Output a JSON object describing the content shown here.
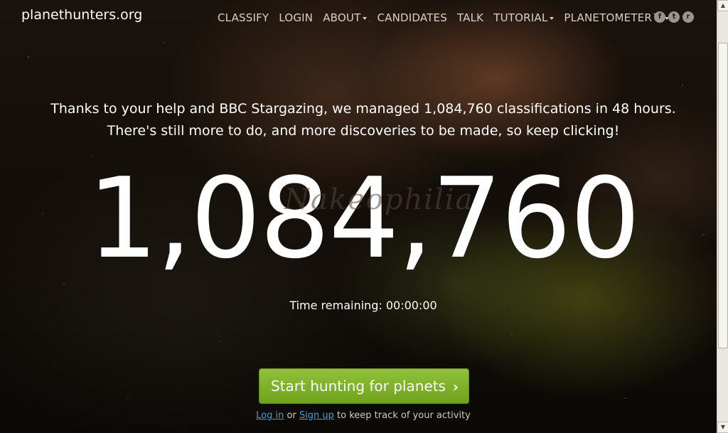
{
  "brand": "planethunters.org",
  "nav": {
    "items": [
      "CLASSIFY",
      "LOGIN",
      "ABOUT",
      "CANDIDATES",
      "TALK",
      "TUTORIAL",
      "PLANETOMETER™"
    ]
  },
  "social": {
    "facebook": "f",
    "twitter": "t",
    "rss": "r"
  },
  "message": {
    "line1": "Thanks to your help and BBC Stargazing, we managed 1,084,760 classifications in 48 hours.",
    "line2": "There's still more to do, and more discoveries to be made, so keep clicking!"
  },
  "count": "1,084,760",
  "watermark": "Nakeophilia",
  "timer": "Time remaining: 00:00:00",
  "cta": {
    "label": "Start hunting for planets",
    "arrow": "›"
  },
  "signin": {
    "login": "Log in",
    "or": " or ",
    "signup": "Sign up",
    "suffix": " to keep track of your activity"
  },
  "scrollbar": {
    "up": "▲",
    "down": "▼"
  }
}
